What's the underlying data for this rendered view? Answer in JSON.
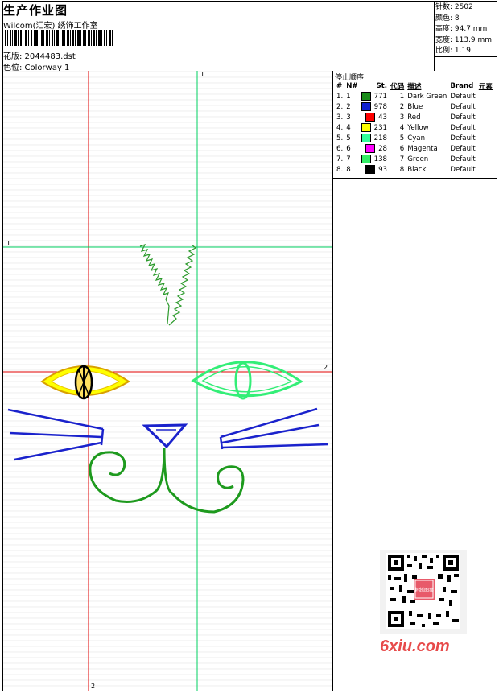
{
  "header": {
    "title": "生产作业图",
    "studio": "Wilcom(汇宏) 绣饰工作室",
    "design_label": "花版: 2044483.dst",
    "colorway_label": "色位: Colorway 1"
  },
  "stats": {
    "stitches": "针数: 2502",
    "colors": "颜色: 8",
    "height": "高度: 94.7 mm",
    "width": "宽度: 113.9 mm",
    "scale": "比例: 1.19"
  },
  "stop_sequence": {
    "title": "停止顺序:",
    "headers": [
      "#",
      "N#",
      "St.",
      "代码",
      "描述",
      "Brand",
      "元素"
    ],
    "rows": [
      {
        "idx": "1.",
        "n": "1",
        "st": "771",
        "code": "1",
        "desc": "Dark Green",
        "brand": "Default",
        "color": "#1a8c1a"
      },
      {
        "idx": "2.",
        "n": "2",
        "st": "978",
        "code": "2",
        "desc": "Blue",
        "brand": "Default",
        "color": "#1020d0"
      },
      {
        "idx": "3.",
        "n": "3",
        "st": "43",
        "code": "3",
        "desc": "Red",
        "brand": "Default",
        "color": "#ff0000"
      },
      {
        "idx": "4.",
        "n": "4",
        "st": "231",
        "code": "4",
        "desc": "Yellow",
        "brand": "Default",
        "color": "#ffff00"
      },
      {
        "idx": "5.",
        "n": "5",
        "st": "218",
        "code": "5",
        "desc": "Cyan",
        "brand": "Default",
        "color": "#33ff99"
      },
      {
        "idx": "6.",
        "n": "6",
        "st": "28",
        "code": "6",
        "desc": "Magenta",
        "brand": "Default",
        "color": "#ff00ff"
      },
      {
        "idx": "7.",
        "n": "7",
        "st": "138",
        "code": "7",
        "desc": "Green",
        "brand": "Default",
        "color": "#33ee66"
      },
      {
        "idx": "8.",
        "n": "8",
        "st": "93",
        "code": "8",
        "desc": "Black",
        "brand": "Default",
        "color": "#000000"
      }
    ]
  },
  "axes": {
    "top_label": "1",
    "left_label": "1",
    "right_label": "2",
    "bottom_label": "2"
  },
  "watermark": {
    "text": "6xiu.com",
    "qr_badge": "刺绣图案"
  }
}
